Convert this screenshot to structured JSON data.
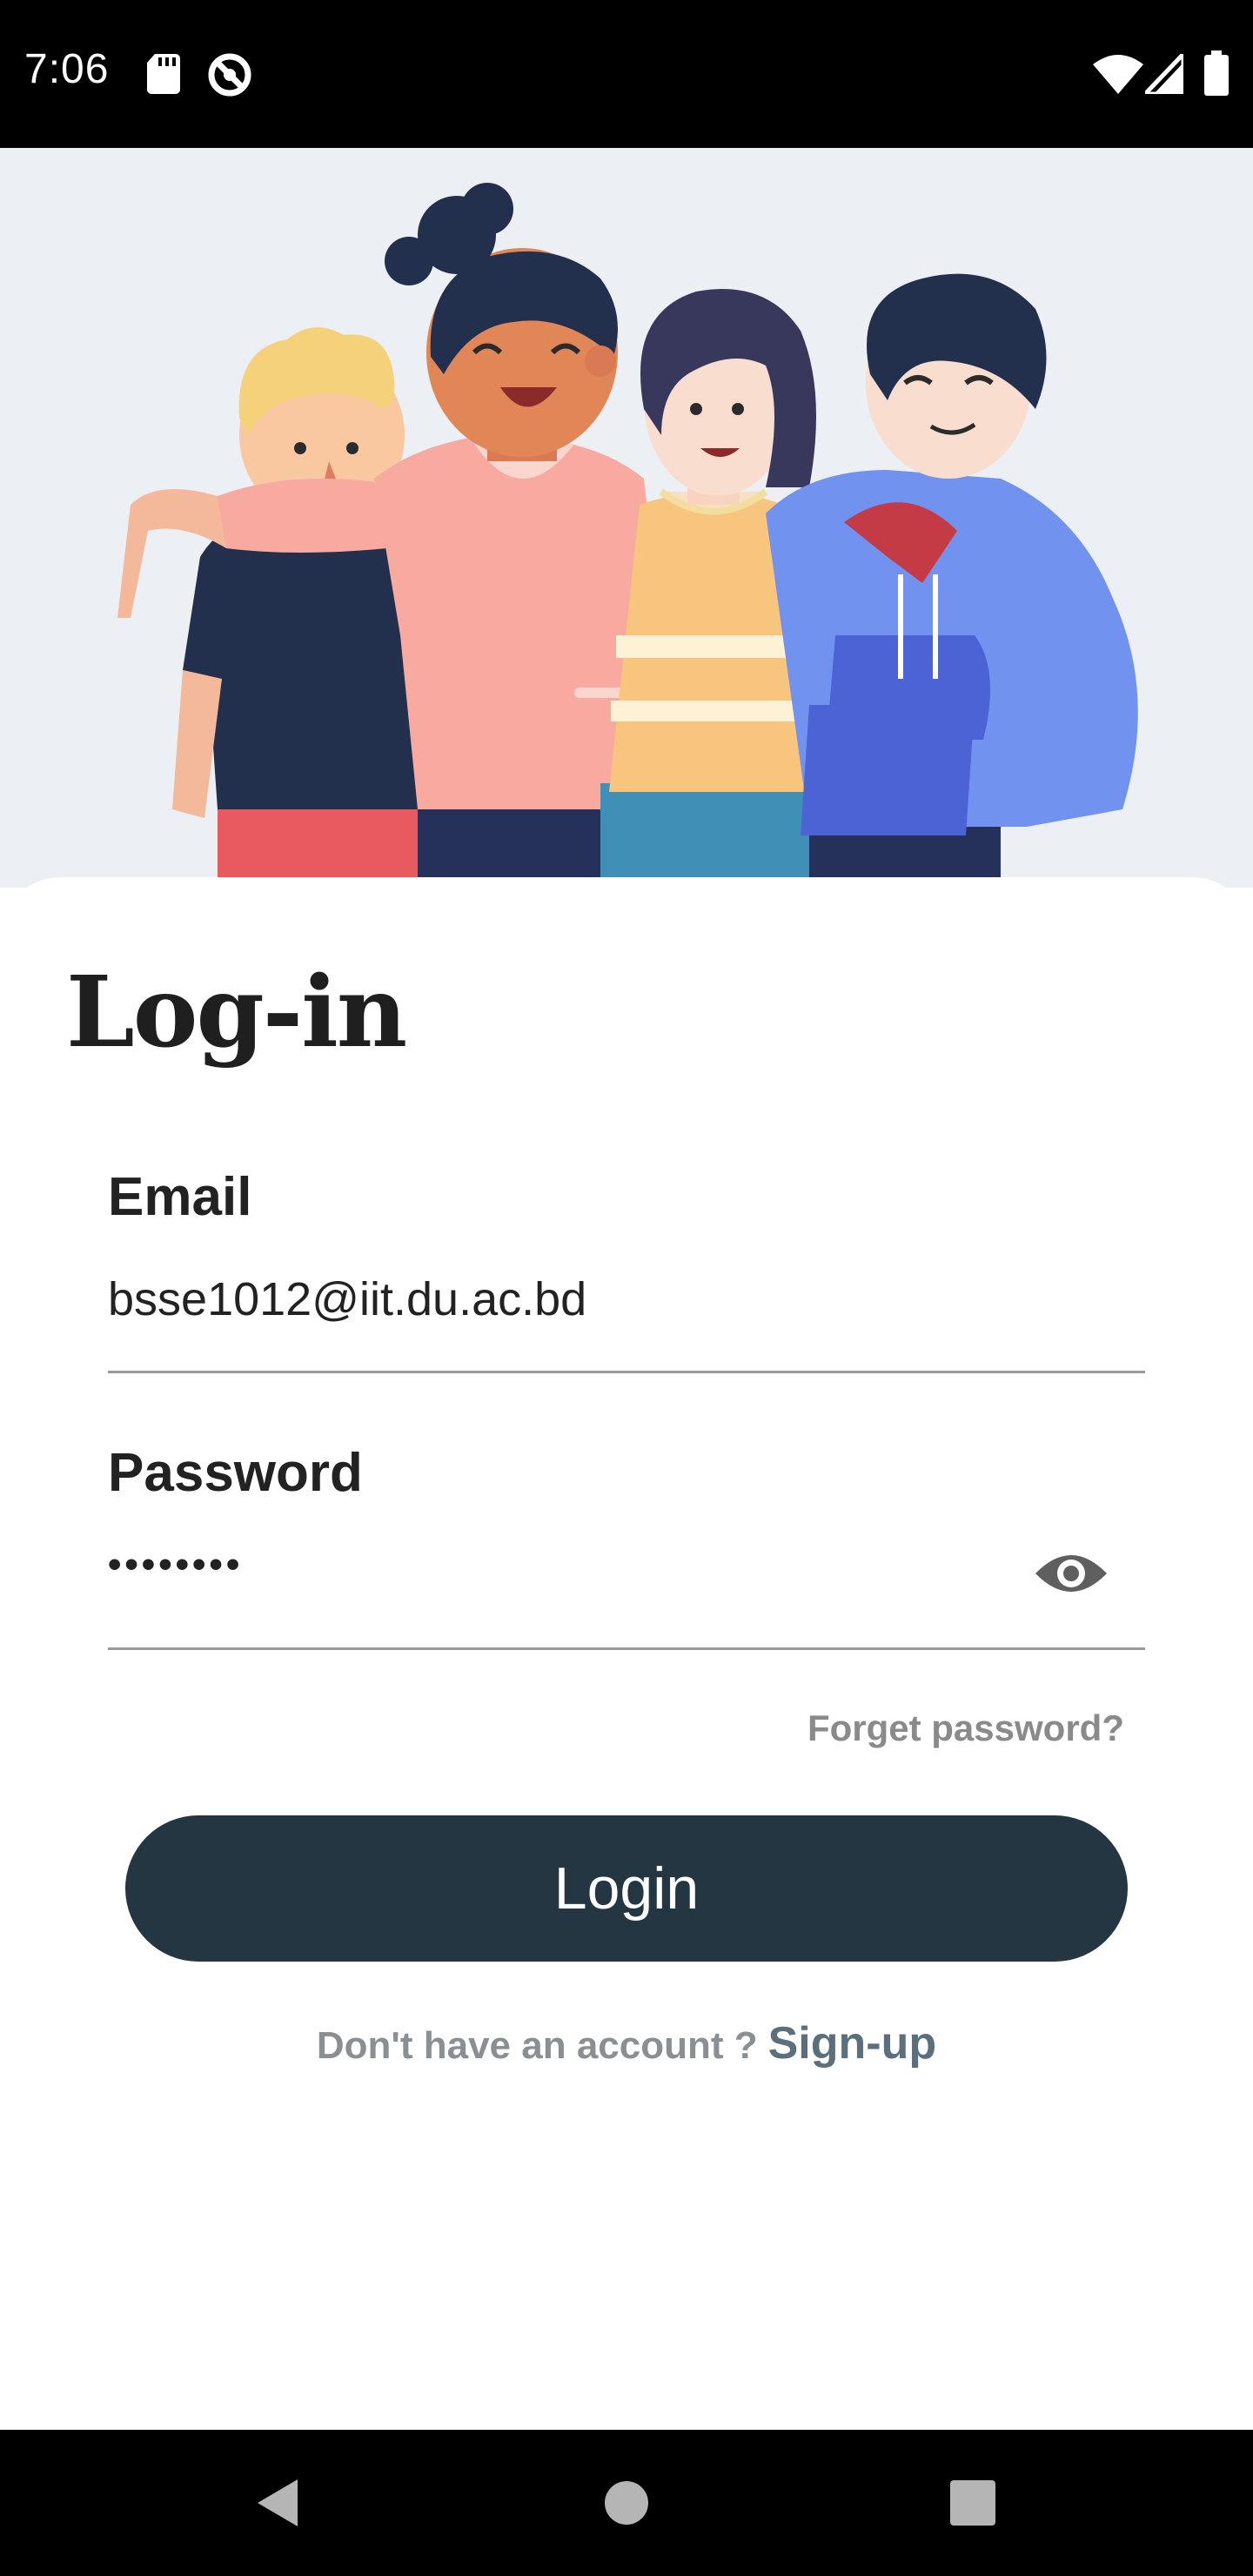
{
  "status_bar": {
    "time": "7:06",
    "left_icons": [
      "sd-card-icon",
      "do-not-disturb-icon"
    ],
    "right_icons": [
      "wifi-icon",
      "signal-icon",
      "battery-icon"
    ]
  },
  "hero": {
    "illustration": "group-of-friends-illustration",
    "colors": {
      "background": "#eceff3"
    }
  },
  "login": {
    "title": "Log-in",
    "email": {
      "label": "Email",
      "value": "bsse1012@iit.du.ac.bd"
    },
    "password": {
      "label": "Password",
      "masked_value": "••••••••",
      "visibility_icon": "eye-icon"
    },
    "forgot_label": "Forget password?",
    "login_button": "Login",
    "signup_prompt": "Don't have an account ?",
    "signup_link": "Sign-up"
  },
  "nav_bar": {
    "icons": [
      "back-icon",
      "home-icon",
      "recents-icon"
    ]
  },
  "colors": {
    "button": "#243641",
    "muted_text": "#8a8a8a",
    "signup_link": "#5c6f7c",
    "title": "#1f1f1f"
  }
}
